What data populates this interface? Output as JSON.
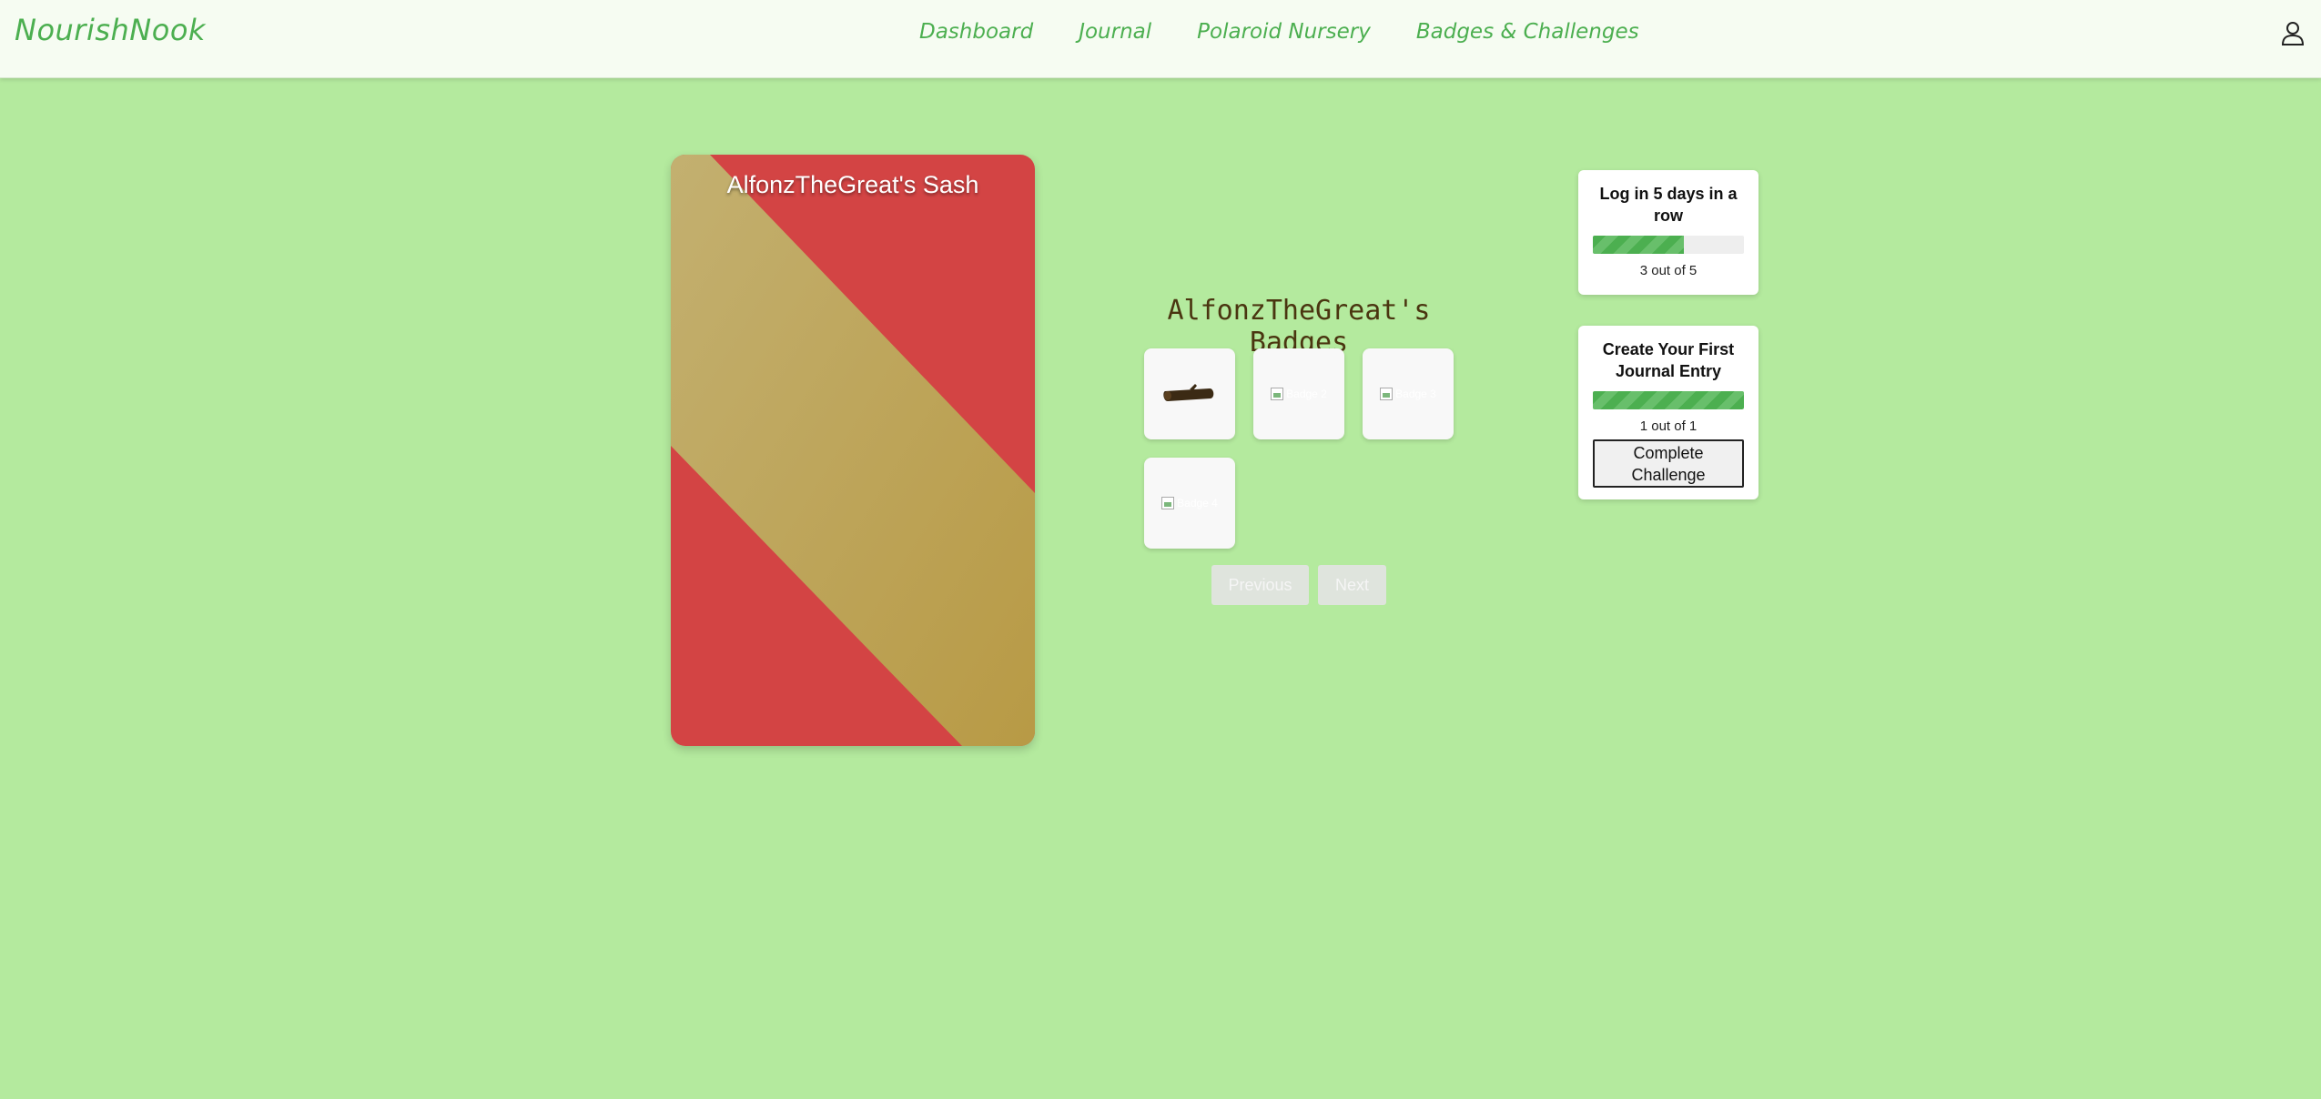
{
  "header": {
    "brand": "NourishNook",
    "nav": [
      "Dashboard",
      "Journal",
      "Polaroid Nursery",
      "Badges & Challenges"
    ],
    "profile_icon": "user-icon"
  },
  "sash": {
    "title": "AlfonzTheGreat's Sash",
    "colors": {
      "base": "#d34444",
      "stripe_light": "#c3b070",
      "stripe_dark": "#b89a45"
    }
  },
  "badges": {
    "title": "AlfonzTheGreat's Badges",
    "items": [
      {
        "icon": "log-icon",
        "alt": ""
      },
      {
        "icon": "broken-image-icon",
        "alt": "Badge 2"
      },
      {
        "icon": "broken-image-icon",
        "alt": "Badge 3"
      },
      {
        "icon": "broken-image-icon",
        "alt": "Badge 4"
      }
    ],
    "previous_label": "Previous",
    "next_label": "Next"
  },
  "challenges": [
    {
      "title": "Log in 5 days in a row",
      "progress_text": "3 out of 5",
      "progress": 0.6
    },
    {
      "title": "Create Your First Journal Entry",
      "progress_text": "1 out of 1",
      "progress": 1.0,
      "button_label": "Complete Challenge"
    }
  ],
  "colors": {
    "background": "#b4ea9e",
    "accent": "#4caf50",
    "header_bg": "#f6fcf2"
  }
}
